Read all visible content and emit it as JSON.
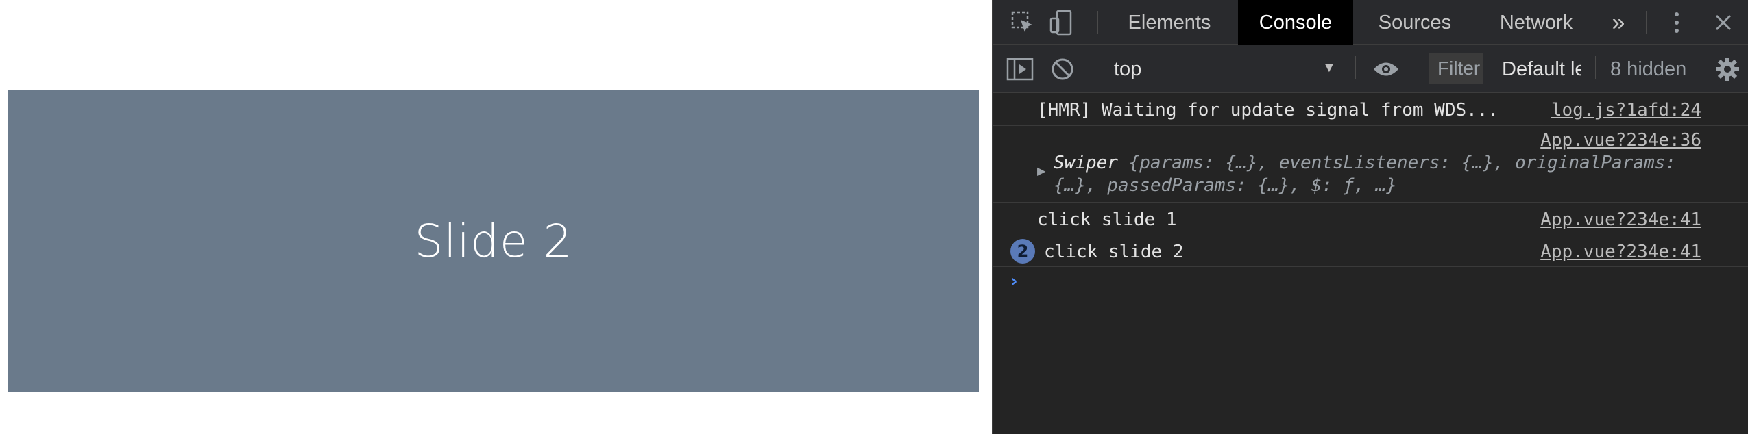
{
  "page": {
    "slide_title": "Slide 2"
  },
  "devtools": {
    "tabs": [
      {
        "label": "Elements"
      },
      {
        "label": "Console"
      },
      {
        "label": "Sources"
      },
      {
        "label": "Network"
      }
    ],
    "more_tabs_glyph": "»",
    "toolbar": {
      "context": "top",
      "filter_placeholder": "Filter",
      "levels_label": "Default levels",
      "hidden_count": "8 hidden"
    },
    "console": {
      "messages": [
        {
          "text": "[HMR] Waiting for update signal from WDS...",
          "source": "log.js?1afd:24"
        },
        {
          "source": "App.vue?234e:36",
          "object_class": "Swiper",
          "object_fields": "{params: {…}, eventsListeners: {…}, originalParams: {…}, passedParams: {…}, $: ƒ, …}"
        },
        {
          "text": "click slide 1",
          "source": "App.vue?234e:41"
        },
        {
          "text": "click slide 2",
          "source": "App.vue?234e:41",
          "repeat_count": "2"
        }
      ],
      "prompt": "›"
    },
    "colors": {
      "accent": "#4f8cf7",
      "slide_bg": "#6a7a8b",
      "panel_bg": "#242424"
    }
  }
}
